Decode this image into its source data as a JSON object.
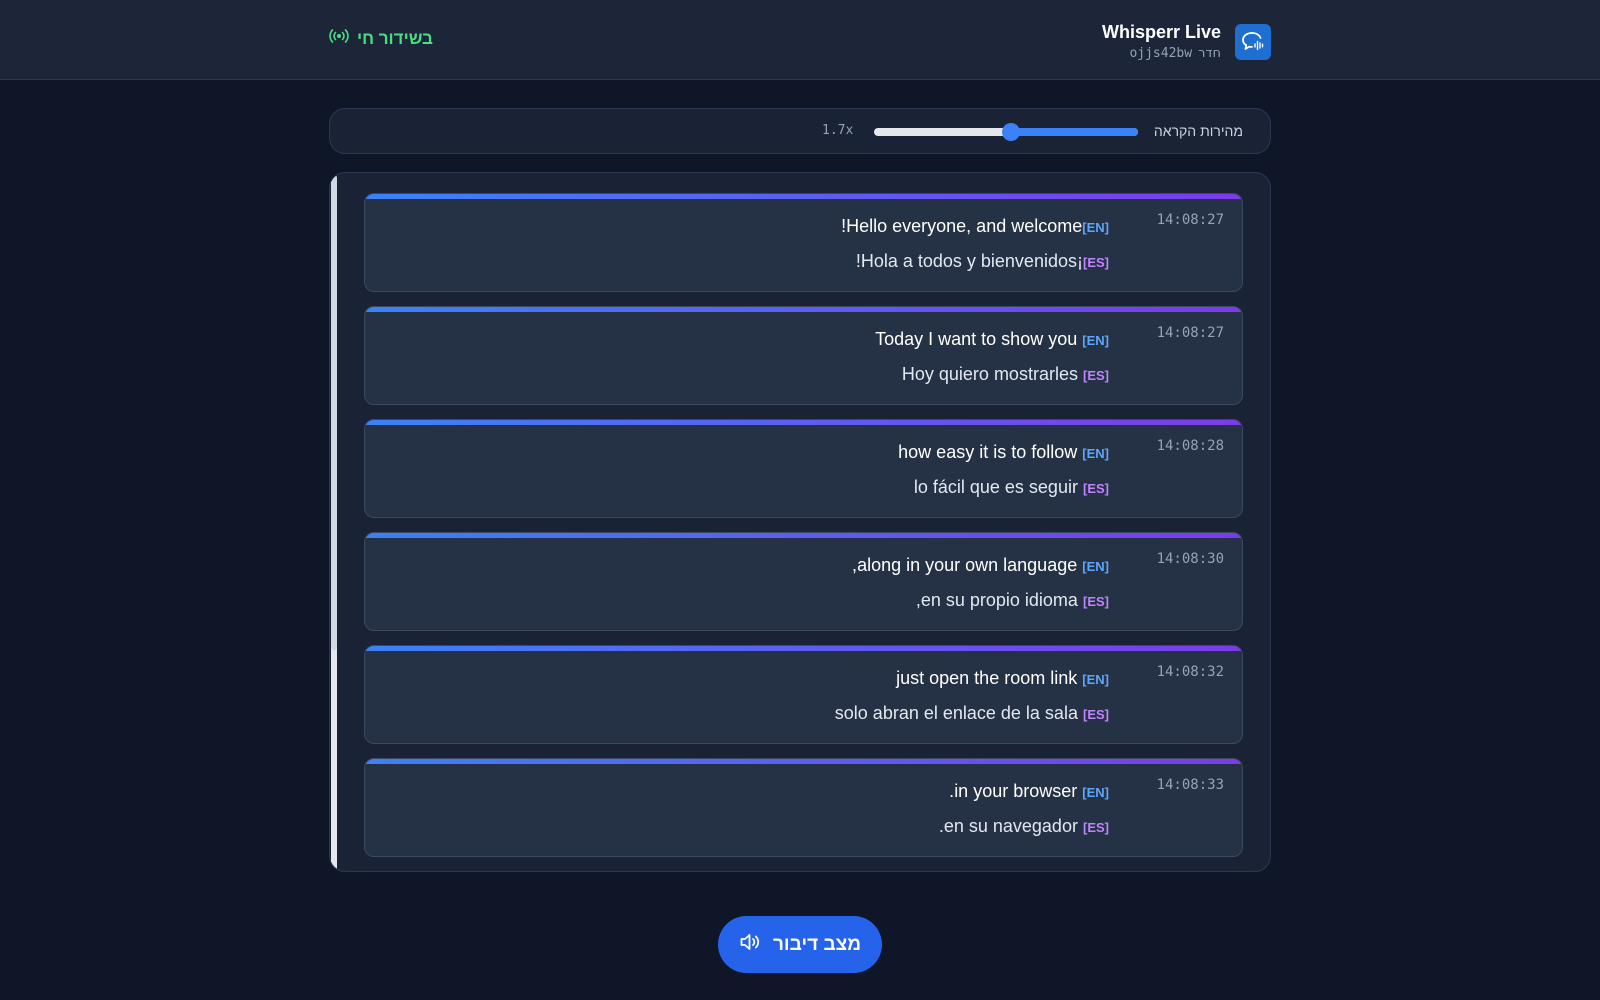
{
  "header": {
    "app_title": "Whisperr Live",
    "room_label": "חדר",
    "room_code": "ojjs42bw",
    "status": "בשידור חי",
    "logo_icon": "chat-sound-icon",
    "status_icon": "broadcast-icon"
  },
  "speed": {
    "label": "מהירות הקראה",
    "value_text": "1.7x",
    "level": 0.48
  },
  "messages": [
    {
      "time": "14:08:27",
      "en_tag": "[EN]",
      "en_text": "Hello everyone, and welcome!",
      "es_tag": "[ES]",
      "es_text": "¡Hola a todos y bienvenidos!"
    },
    {
      "time": "14:08:27",
      "en_tag": "[EN]",
      "en_text": "Today I want to show you",
      "es_tag": "[ES]",
      "es_text": "Hoy quiero mostrarles"
    },
    {
      "time": "14:08:28",
      "en_tag": "[EN]",
      "en_text": "how easy it is to follow",
      "es_tag": "[ES]",
      "es_text": "lo fácil que es seguir"
    },
    {
      "time": "14:08:30",
      "en_tag": "[EN]",
      "en_text": "along in your own language,",
      "es_tag": "[ES]",
      "es_text": "en su propio idioma,"
    },
    {
      "time": "14:08:32",
      "en_tag": "[EN]",
      "en_text": "just open the room link",
      "es_tag": "[ES]",
      "es_text": "solo abran el enlace de la sala"
    },
    {
      "time": "14:08:33",
      "en_tag": "[EN]",
      "en_text": "in your browser.",
      "es_tag": "[ES]",
      "es_text": "en su navegador."
    }
  ],
  "speak_button": {
    "label": "מצב דיבור",
    "icon": "speaker-icon"
  },
  "colors": {
    "accent": "#3b82f6",
    "accent_purple": "#7c3aed",
    "live_green": "#4ade80",
    "en_tag": "#60a5fa",
    "es_tag": "#c084fc",
    "button": "#2563eb"
  }
}
